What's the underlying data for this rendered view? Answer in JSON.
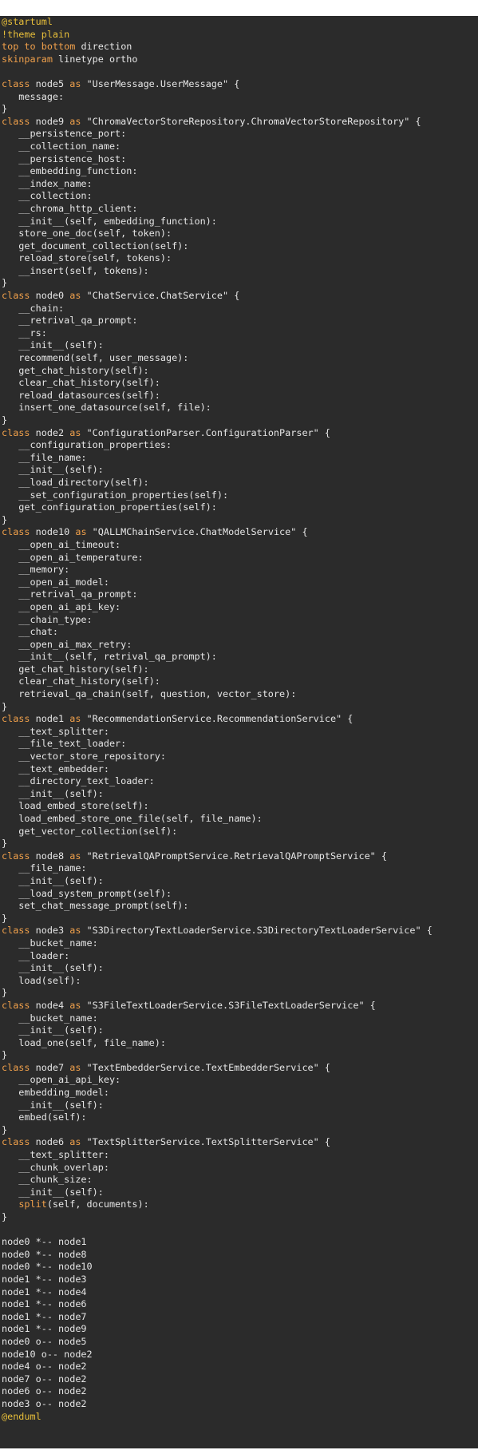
{
  "colors": {
    "background": "#2b2b2b",
    "text": "#e6e6e6",
    "keyword": "#f0a04b",
    "directive": "#e8bf3a"
  },
  "lines": [
    [
      [
        "dir",
        "@startuml"
      ]
    ],
    [
      [
        "dir",
        "!theme plain"
      ]
    ],
    [
      [
        "kw",
        "top"
      ],
      [
        "pl",
        " "
      ],
      [
        "kw",
        "to"
      ],
      [
        "pl",
        " "
      ],
      [
        "kw",
        "bottom"
      ],
      [
        "pl",
        " direction"
      ]
    ],
    [
      [
        "kw",
        "skinparam"
      ],
      [
        "pl",
        " linetype ortho"
      ]
    ],
    [
      [
        "pl",
        ""
      ]
    ],
    [
      [
        "kw",
        "class"
      ],
      [
        "pl",
        " node5 "
      ],
      [
        "kw",
        "as"
      ],
      [
        "pl",
        " \"UserMessage.UserMessage\" {"
      ]
    ],
    [
      [
        "pl",
        "   message:"
      ]
    ],
    [
      [
        "pl",
        "}"
      ]
    ],
    [
      [
        "kw",
        "class"
      ],
      [
        "pl",
        " node9 "
      ],
      [
        "kw",
        "as"
      ],
      [
        "pl",
        " \"ChromaVectorStoreRepository.ChromaVectorStoreRepository\" {"
      ]
    ],
    [
      [
        "pl",
        "   __persistence_port:"
      ]
    ],
    [
      [
        "pl",
        "   __collection_name:"
      ]
    ],
    [
      [
        "pl",
        "   __persistence_host:"
      ]
    ],
    [
      [
        "pl",
        "   __embedding_function:"
      ]
    ],
    [
      [
        "pl",
        "   __index_name:"
      ]
    ],
    [
      [
        "pl",
        "   __collection:"
      ]
    ],
    [
      [
        "pl",
        "   __chroma_http_client:"
      ]
    ],
    [
      [
        "pl",
        "   __init__(self, embedding_function):"
      ]
    ],
    [
      [
        "pl",
        "   store_one_doc(self, token):"
      ]
    ],
    [
      [
        "pl",
        "   get_document_collection(self):"
      ]
    ],
    [
      [
        "pl",
        "   reload_store(self, tokens):"
      ]
    ],
    [
      [
        "pl",
        "   __insert(self, tokens):"
      ]
    ],
    [
      [
        "pl",
        "}"
      ]
    ],
    [
      [
        "kw",
        "class"
      ],
      [
        "pl",
        " node0 "
      ],
      [
        "kw",
        "as"
      ],
      [
        "pl",
        " \"ChatService.ChatService\" {"
      ]
    ],
    [
      [
        "pl",
        "   __chain:"
      ]
    ],
    [
      [
        "pl",
        "   __retrival_qa_prompt:"
      ]
    ],
    [
      [
        "pl",
        "   __rs:"
      ]
    ],
    [
      [
        "pl",
        "   __init__(self):"
      ]
    ],
    [
      [
        "pl",
        "   recommend(self, user_message):"
      ]
    ],
    [
      [
        "pl",
        "   get_chat_history(self):"
      ]
    ],
    [
      [
        "pl",
        "   clear_chat_history(self):"
      ]
    ],
    [
      [
        "pl",
        "   reload_datasources(self):"
      ]
    ],
    [
      [
        "pl",
        "   insert_one_datasource(self, file):"
      ]
    ],
    [
      [
        "pl",
        "}"
      ]
    ],
    [
      [
        "kw",
        "class"
      ],
      [
        "pl",
        " node2 "
      ],
      [
        "kw",
        "as"
      ],
      [
        "pl",
        " \"ConfigurationParser.ConfigurationParser\" {"
      ]
    ],
    [
      [
        "pl",
        "   __configuration_properties:"
      ]
    ],
    [
      [
        "pl",
        "   __file_name:"
      ]
    ],
    [
      [
        "pl",
        "   __init__(self):"
      ]
    ],
    [
      [
        "pl",
        "   __load_directory(self):"
      ]
    ],
    [
      [
        "pl",
        "   __set_configuration_properties(self):"
      ]
    ],
    [
      [
        "pl",
        "   get_configuration_properties(self):"
      ]
    ],
    [
      [
        "pl",
        "}"
      ]
    ],
    [
      [
        "kw",
        "class"
      ],
      [
        "pl",
        " node10 "
      ],
      [
        "kw",
        "as"
      ],
      [
        "pl",
        " \"QALLMChainService.ChatModelService\" {"
      ]
    ],
    [
      [
        "pl",
        "   __open_ai_timeout:"
      ]
    ],
    [
      [
        "pl",
        "   __open_ai_temperature:"
      ]
    ],
    [
      [
        "pl",
        "   __memory:"
      ]
    ],
    [
      [
        "pl",
        "   __open_ai_model:"
      ]
    ],
    [
      [
        "pl",
        "   __retrival_qa_prompt:"
      ]
    ],
    [
      [
        "pl",
        "   __open_ai_api_key:"
      ]
    ],
    [
      [
        "pl",
        "   __chain_type:"
      ]
    ],
    [
      [
        "pl",
        "   __chat:"
      ]
    ],
    [
      [
        "pl",
        "   __open_ai_max_retry:"
      ]
    ],
    [
      [
        "pl",
        "   __init__(self, retrival_qa_prompt):"
      ]
    ],
    [
      [
        "pl",
        "   get_chat_history(self):"
      ]
    ],
    [
      [
        "pl",
        "   clear_chat_history(self):"
      ]
    ],
    [
      [
        "pl",
        "   retrieval_qa_chain(self, question, vector_store):"
      ]
    ],
    [
      [
        "pl",
        "}"
      ]
    ],
    [
      [
        "kw",
        "class"
      ],
      [
        "pl",
        " node1 "
      ],
      [
        "kw",
        "as"
      ],
      [
        "pl",
        " \"RecommendationService.RecommendationService\" {"
      ]
    ],
    [
      [
        "pl",
        "   __text_splitter:"
      ]
    ],
    [
      [
        "pl",
        "   __file_text_loader:"
      ]
    ],
    [
      [
        "pl",
        "   __vector_store_repository:"
      ]
    ],
    [
      [
        "pl",
        "   __text_embedder:"
      ]
    ],
    [
      [
        "pl",
        "   __directory_text_loader:"
      ]
    ],
    [
      [
        "pl",
        "   __init__(self):"
      ]
    ],
    [
      [
        "pl",
        "   load_embed_store(self):"
      ]
    ],
    [
      [
        "pl",
        "   load_embed_store_one_file(self, file_name):"
      ]
    ],
    [
      [
        "pl",
        "   get_vector_collection(self):"
      ]
    ],
    [
      [
        "pl",
        "}"
      ]
    ],
    [
      [
        "kw",
        "class"
      ],
      [
        "pl",
        " node8 "
      ],
      [
        "kw",
        "as"
      ],
      [
        "pl",
        " \"RetrievalQAPromptService.RetrievalQAPromptService\" {"
      ]
    ],
    [
      [
        "pl",
        "   __file_name:"
      ]
    ],
    [
      [
        "pl",
        "   __init__(self):"
      ]
    ],
    [
      [
        "pl",
        "   __load_system_prompt(self):"
      ]
    ],
    [
      [
        "pl",
        "   set_chat_message_prompt(self):"
      ]
    ],
    [
      [
        "pl",
        "}"
      ]
    ],
    [
      [
        "kw",
        "class"
      ],
      [
        "pl",
        " node3 "
      ],
      [
        "kw",
        "as"
      ],
      [
        "pl",
        " \"S3DirectoryTextLoaderService.S3DirectoryTextLoaderService\" {"
      ]
    ],
    [
      [
        "pl",
        "   __bucket_name:"
      ]
    ],
    [
      [
        "pl",
        "   __loader:"
      ]
    ],
    [
      [
        "pl",
        "   __init__(self):"
      ]
    ],
    [
      [
        "pl",
        "   load(self):"
      ]
    ],
    [
      [
        "pl",
        "}"
      ]
    ],
    [
      [
        "kw",
        "class"
      ],
      [
        "pl",
        " node4 "
      ],
      [
        "kw",
        "as"
      ],
      [
        "pl",
        " \"S3FileTextLoaderService.S3FileTextLoaderService\" {"
      ]
    ],
    [
      [
        "pl",
        "   __bucket_name:"
      ]
    ],
    [
      [
        "pl",
        "   __init__(self):"
      ]
    ],
    [
      [
        "pl",
        "   load_one(self, file_name):"
      ]
    ],
    [
      [
        "pl",
        "}"
      ]
    ],
    [
      [
        "kw",
        "class"
      ],
      [
        "pl",
        " node7 "
      ],
      [
        "kw",
        "as"
      ],
      [
        "pl",
        " \"TextEmbedderService.TextEmbedderService\" {"
      ]
    ],
    [
      [
        "pl",
        "   __open_ai_api_key:"
      ]
    ],
    [
      [
        "pl",
        "   embedding_model:"
      ]
    ],
    [
      [
        "pl",
        "   __init__(self):"
      ]
    ],
    [
      [
        "pl",
        "   embed(self):"
      ]
    ],
    [
      [
        "pl",
        "}"
      ]
    ],
    [
      [
        "kw",
        "class"
      ],
      [
        "pl",
        " node6 "
      ],
      [
        "kw",
        "as"
      ],
      [
        "pl",
        " \"TextSplitterService.TextSplitterService\" {"
      ]
    ],
    [
      [
        "pl",
        "   __text_splitter:"
      ]
    ],
    [
      [
        "pl",
        "   __chunk_overlap:"
      ]
    ],
    [
      [
        "pl",
        "   __chunk_size:"
      ]
    ],
    [
      [
        "pl",
        "   __init__(self):"
      ]
    ],
    [
      [
        "pl",
        "   "
      ],
      [
        "kw",
        "split"
      ],
      [
        "pl",
        "(self, documents):"
      ]
    ],
    [
      [
        "pl",
        "}"
      ]
    ],
    [
      [
        "pl",
        ""
      ]
    ],
    [
      [
        "pl",
        "node0 *-- node1"
      ]
    ],
    [
      [
        "pl",
        "node0 *-- node8"
      ]
    ],
    [
      [
        "pl",
        "node0 *-- node10"
      ]
    ],
    [
      [
        "pl",
        "node1 *-- node3"
      ]
    ],
    [
      [
        "pl",
        "node1 *-- node4"
      ]
    ],
    [
      [
        "pl",
        "node1 *-- node6"
      ]
    ],
    [
      [
        "pl",
        "node1 *-- node7"
      ]
    ],
    [
      [
        "pl",
        "node1 *-- node9"
      ]
    ],
    [
      [
        "pl",
        "node0 o-- node5"
      ]
    ],
    [
      [
        "pl",
        "node10 o-- node2"
      ]
    ],
    [
      [
        "pl",
        "node4 o-- node2"
      ]
    ],
    [
      [
        "pl",
        "node7 o-- node2"
      ]
    ],
    [
      [
        "pl",
        "node6 o-- node2"
      ]
    ],
    [
      [
        "pl",
        "node3 o-- node2"
      ]
    ],
    [
      [
        "dir",
        "@enduml"
      ]
    ]
  ]
}
